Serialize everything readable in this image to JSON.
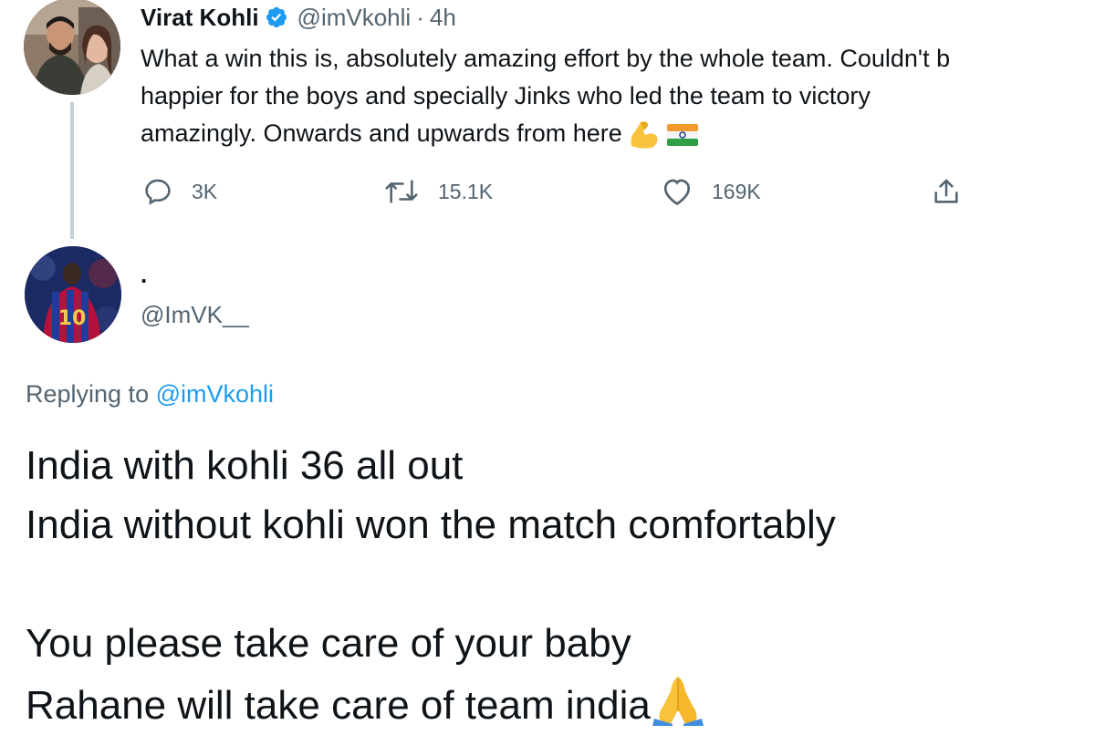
{
  "tweet": {
    "author": {
      "name": "Virat Kohli",
      "handle": "@imVkohli",
      "verified": true,
      "avatar_icon": "couple-photo-avatar"
    },
    "separator": "·",
    "timestamp": "4h",
    "text_lines": [
      "What a win this is, absolutely amazing effort by the whole team. Couldn't b",
      "happier for the boys and specially Jinks who led the team to victory",
      "amazingly. Onwards and upwards from here"
    ],
    "emojis": [
      "flexed-biceps-emoji",
      "india-flag-emoji"
    ],
    "actions": {
      "reply": {
        "icon": "reply-icon",
        "count": "3K"
      },
      "retweet": {
        "icon": "retweet-icon",
        "count": "15.1K"
      },
      "like": {
        "icon": "heart-icon",
        "count": "169K"
      },
      "share": {
        "icon": "share-icon"
      }
    }
  },
  "reply": {
    "author": {
      "name": ".",
      "handle": "@ImVK__",
      "avatar_icon": "football-jersey-avatar"
    },
    "replying_to_label": "Replying to",
    "replying_to_handle": "@imVkohli",
    "text_lines": [
      "India with kohli 36 all out",
      "India without kohli won the match comfortably",
      "",
      "You please take care of your baby",
      "Rahane will take care of team india"
    ],
    "emoji": "folded-hands-emoji"
  },
  "colors": {
    "text_primary": "#0f1419",
    "text_secondary": "#536471",
    "link": "#1d9bf0",
    "verified": "#1d9bf0",
    "thread_line": "#c4cfd6"
  }
}
